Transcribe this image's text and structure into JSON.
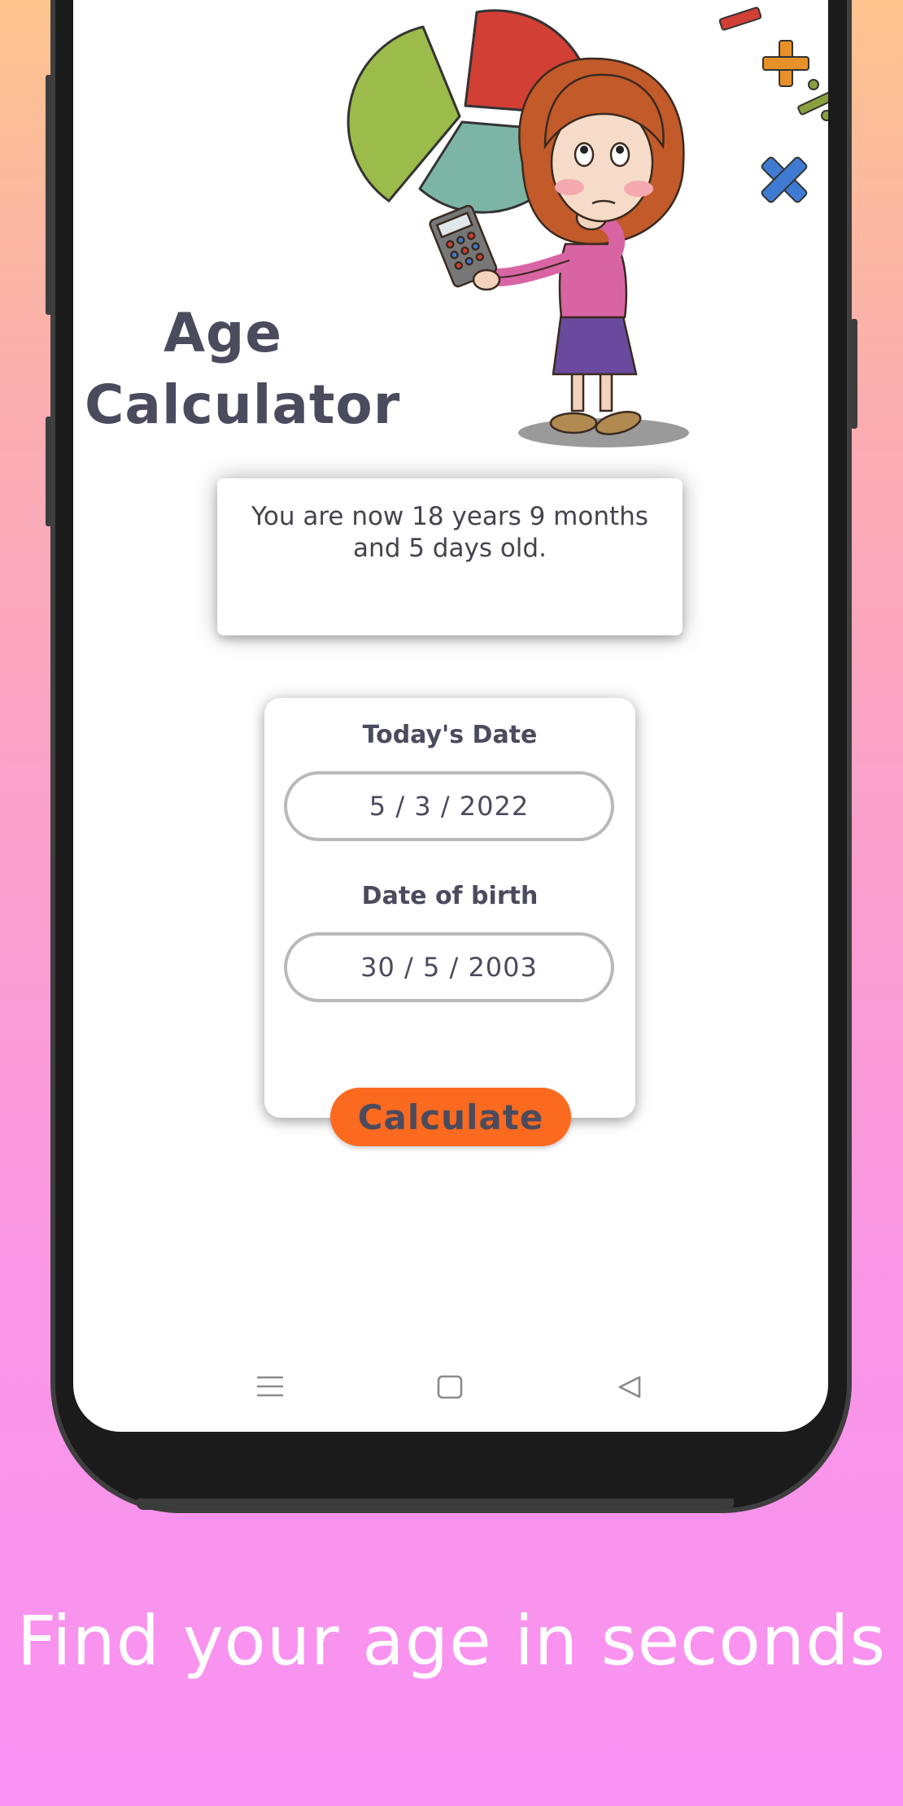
{
  "app": {
    "title_line1": "Age",
    "title_line2": "Calculator"
  },
  "result": {
    "message": "You are now 18 years 9 months and 5 days old."
  },
  "form": {
    "today_label": "Today's Date",
    "today_value": "5 / 3 / 2022",
    "dob_label": "Date of birth",
    "dob_value": "30 / 5 / 2003",
    "calculate_label": "Calculate"
  },
  "navbar": {
    "icons": [
      "menu-icon",
      "home-square-icon",
      "back-triangle-icon"
    ]
  },
  "tagline": "Find your age in seconds",
  "colors": {
    "accent": "#fb6a1f",
    "text_dark": "#4b4b5e",
    "pie_red": "#d13f35",
    "pie_green": "#9bbb4a",
    "pie_teal": "#7cb5a5"
  }
}
